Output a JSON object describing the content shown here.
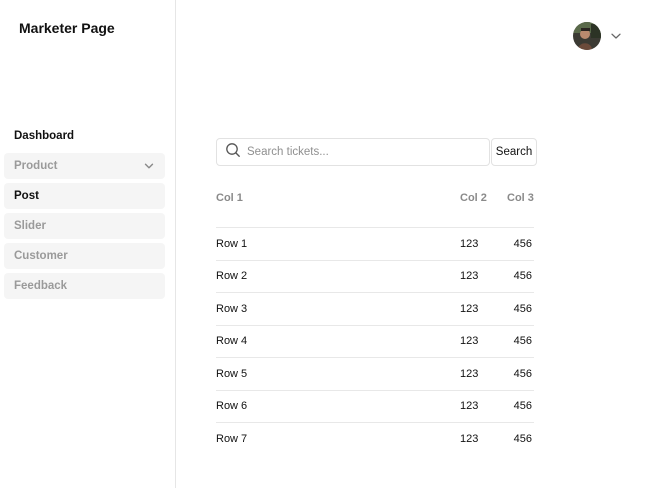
{
  "app": {
    "title": "Marketer Page"
  },
  "sidebar": {
    "items": [
      {
        "label": "Dashboard"
      },
      {
        "label": "Product"
      },
      {
        "label": "Post"
      },
      {
        "label": "Slider"
      },
      {
        "label": "Customer"
      },
      {
        "label": "Feedback"
      }
    ]
  },
  "header": {
    "avatar_icon": "user-avatar",
    "menu_icon": "chevron-down-icon"
  },
  "search": {
    "placeholder": "Search tickets...",
    "value": "",
    "button_label": "Search"
  },
  "table": {
    "columns": [
      "Col 1",
      "Col 2",
      "Col 3"
    ],
    "rows": [
      [
        "Row 1",
        "123",
        "456"
      ],
      [
        "Row 2",
        "123",
        "456"
      ],
      [
        "Row 3",
        "123",
        "456"
      ],
      [
        "Row 4",
        "123",
        "456"
      ],
      [
        "Row 5",
        "123",
        "456"
      ],
      [
        "Row 6",
        "123",
        "456"
      ],
      [
        "Row 7",
        "123",
        "456"
      ]
    ]
  }
}
